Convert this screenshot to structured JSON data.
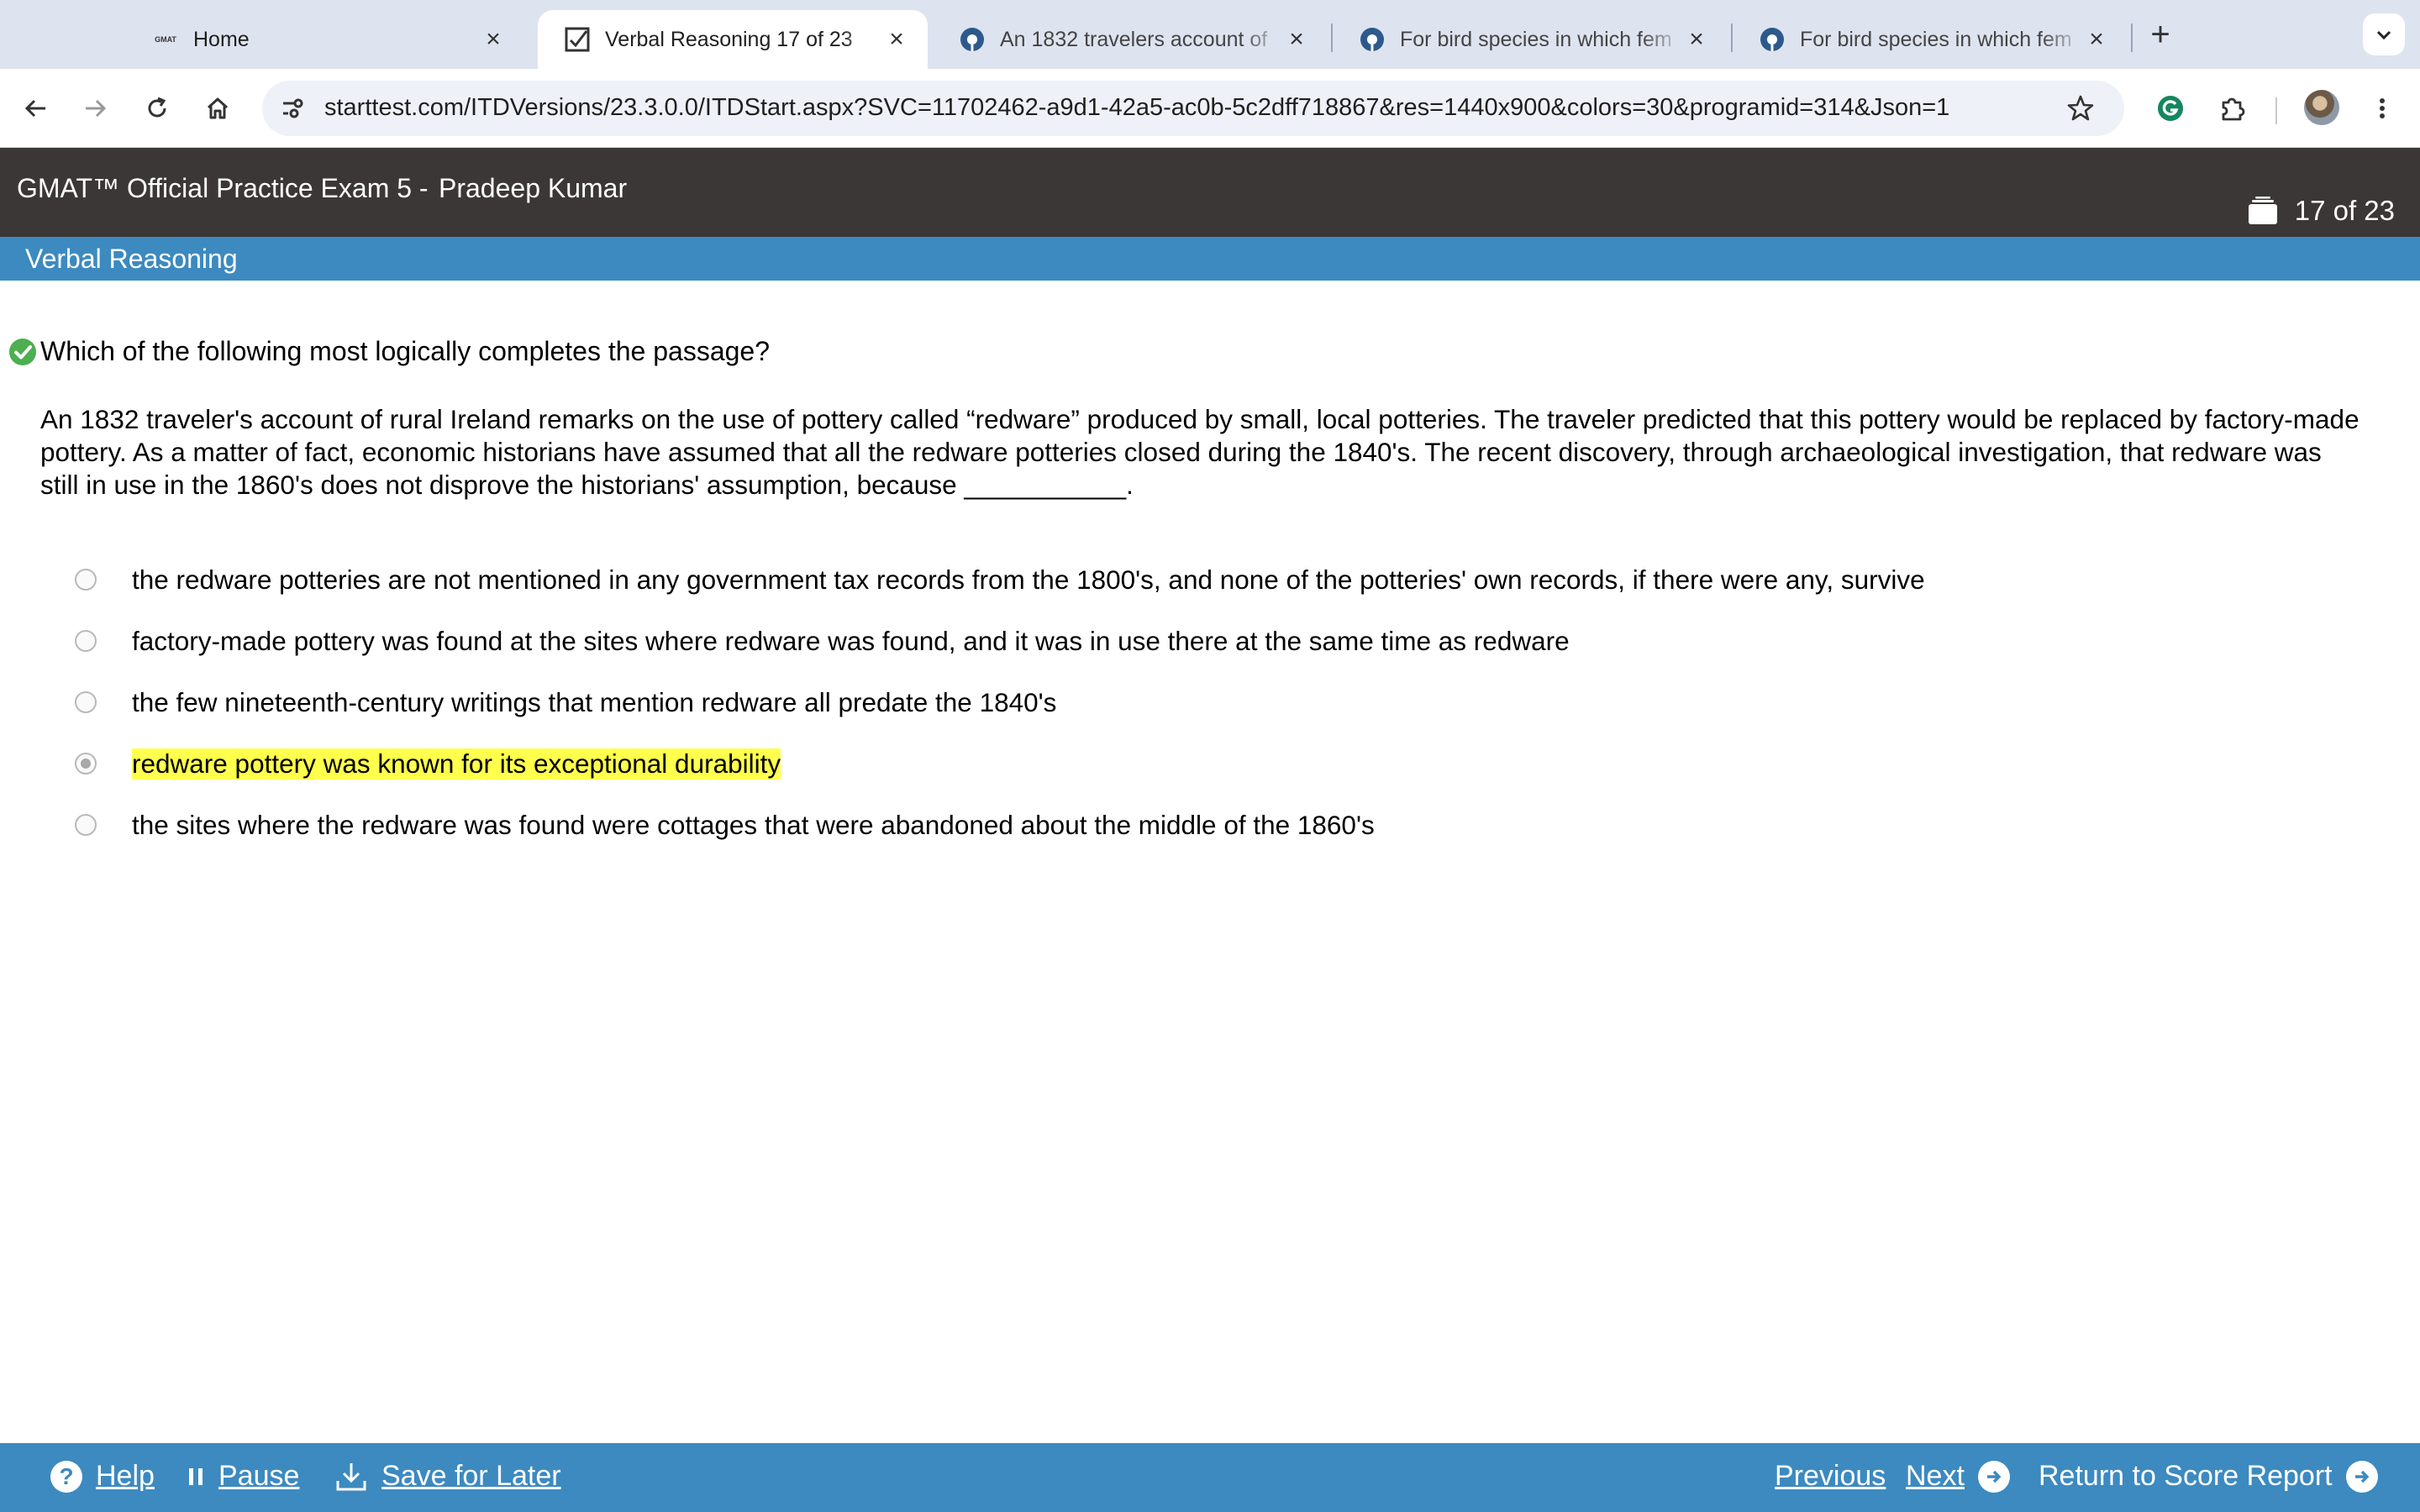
{
  "browser": {
    "tabs": [
      {
        "label": "Home",
        "favicon": "gmat-favicon",
        "favicon_text": "GMAT",
        "active": false
      },
      {
        "label": "Verbal Reasoning 17 of 23",
        "favicon": "exam-check-icon",
        "active": true
      },
      {
        "label": "An 1832 travelers account of",
        "favicon": "forum-icon",
        "active": false
      },
      {
        "label": "For bird species in which fem",
        "favicon": "forum-icon",
        "active": false
      },
      {
        "label": "For bird species in which fem",
        "favicon": "forum-icon",
        "active": false
      }
    ],
    "url": "starttest.com/ITDVersions/23.3.0.0/ITDStart.aspx?SVC=11702462-a9d1-42a5-ac0b-5c2dff718867&res=1440x900&colors=30&programid=314&Json=1"
  },
  "exam": {
    "title": "GMAT™ Official Practice Exam 5 -",
    "candidate": "Pradeep Kumar",
    "progress": "17 of 23",
    "section": "Verbal Reasoning"
  },
  "question": {
    "prompt": "Which of the following most logically completes the passage?",
    "passage": "An 1832 traveler's account of rural Ireland remarks on the use of pottery called “redware” produced by small, local potteries. The traveler predicted that this pottery would be replaced by factory-made pottery. As a matter of fact, economic historians have assumed that all the redware potteries closed during the 1840's. The recent discovery, through archaeological investigation, that redware was still in use in the 1860's does not disprove the historians' assumption, because ___________.",
    "options": [
      {
        "text": "the redware potteries are not mentioned in any government tax records from the 1800's, and none of the potteries' own records, if there were any, survive",
        "selected": false
      },
      {
        "text": "factory-made pottery was found at the sites where redware was found, and it was in use there at the same time as redware",
        "selected": false
      },
      {
        "text": "the few nineteenth-century writings that mention redware all predate the 1840's",
        "selected": false
      },
      {
        "text": "redware pottery was known for its exceptional durability",
        "selected": true,
        "highlighted": true
      },
      {
        "text": "the sites where the redware was found were cottages that were abandoned about the middle of the 1860's",
        "selected": false
      }
    ]
  },
  "footer": {
    "help": "Help",
    "pause": "Pause",
    "save": "Save for Later",
    "previous": "Previous",
    "next": "Next",
    "return": "Return to Score Report"
  },
  "colors": {
    "section_bar": "#3c8ac0",
    "header_bg": "#3a3736",
    "highlight": "#ffff4d",
    "check": "#4caf50"
  }
}
